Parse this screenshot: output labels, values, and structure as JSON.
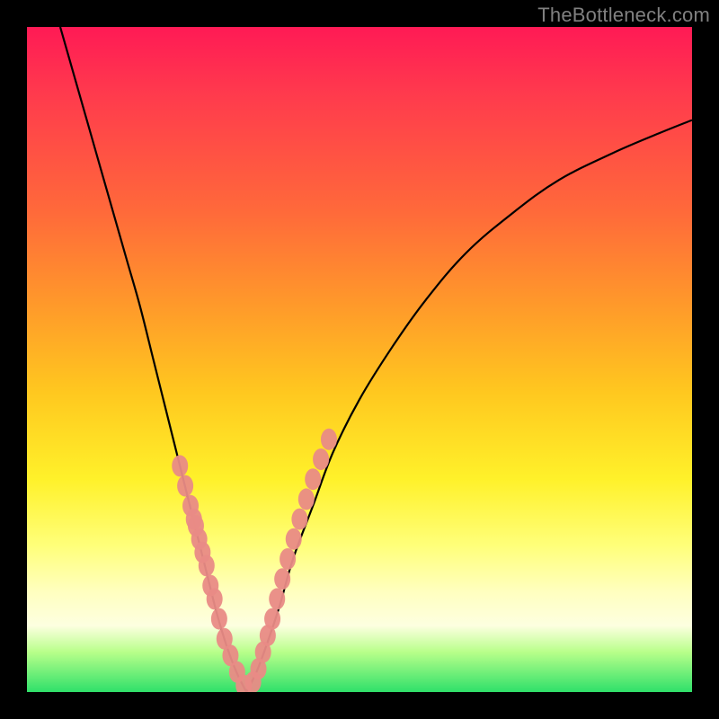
{
  "watermark": "TheBottleneck.com",
  "chart_data": {
    "type": "line",
    "title": "",
    "xlabel": "",
    "ylabel": "",
    "xlim": [
      0,
      100
    ],
    "ylim": [
      0,
      100
    ],
    "curves": {
      "left": {
        "x": [
          5,
          7,
          9,
          11,
          13,
          15,
          17,
          19,
          21,
          23,
          25,
          27,
          28.5,
          30,
          31.5,
          33
        ],
        "y": [
          100,
          93,
          86,
          79,
          72,
          65,
          58,
          50,
          42,
          34,
          26,
          18,
          12,
          7,
          3,
          0
        ]
      },
      "right": {
        "x": [
          33,
          34.5,
          36,
          38,
          40,
          43,
          46,
          50,
          55,
          60,
          66,
          73,
          80,
          88,
          95,
          100
        ],
        "y": [
          0,
          3,
          7,
          13,
          20,
          28,
          36,
          44,
          52,
          59,
          66,
          72,
          77,
          81,
          84,
          86
        ]
      }
    },
    "markers": {
      "note": "salmon dot clusters near the bottom of the V",
      "color": "#e98b86",
      "left_cluster": {
        "x": [
          23.0,
          23.8,
          24.6,
          25.1,
          25.4,
          25.9,
          26.4,
          27.0,
          27.6,
          28.2,
          28.9,
          29.7,
          30.6,
          31.6,
          32.6
        ],
        "y": [
          34.0,
          31.0,
          28.0,
          26.0,
          25.0,
          23.0,
          21.0,
          19.0,
          16.0,
          14.0,
          11.0,
          8.0,
          5.5,
          3.0,
          1.0
        ]
      },
      "right_cluster": {
        "x": [
          34.0,
          34.8,
          35.5,
          36.2,
          36.9,
          37.6,
          38.4,
          39.2,
          40.1,
          41.0,
          42.0,
          43.0,
          44.2,
          45.4
        ],
        "y": [
          1.5,
          3.5,
          6.0,
          8.5,
          11.0,
          14.0,
          17.0,
          20.0,
          23.0,
          26.0,
          29.0,
          32.0,
          35.0,
          38.0
        ]
      }
    },
    "colors": {
      "curve": "#000000",
      "marker": "#e98b86",
      "frame": "#000000"
    }
  }
}
